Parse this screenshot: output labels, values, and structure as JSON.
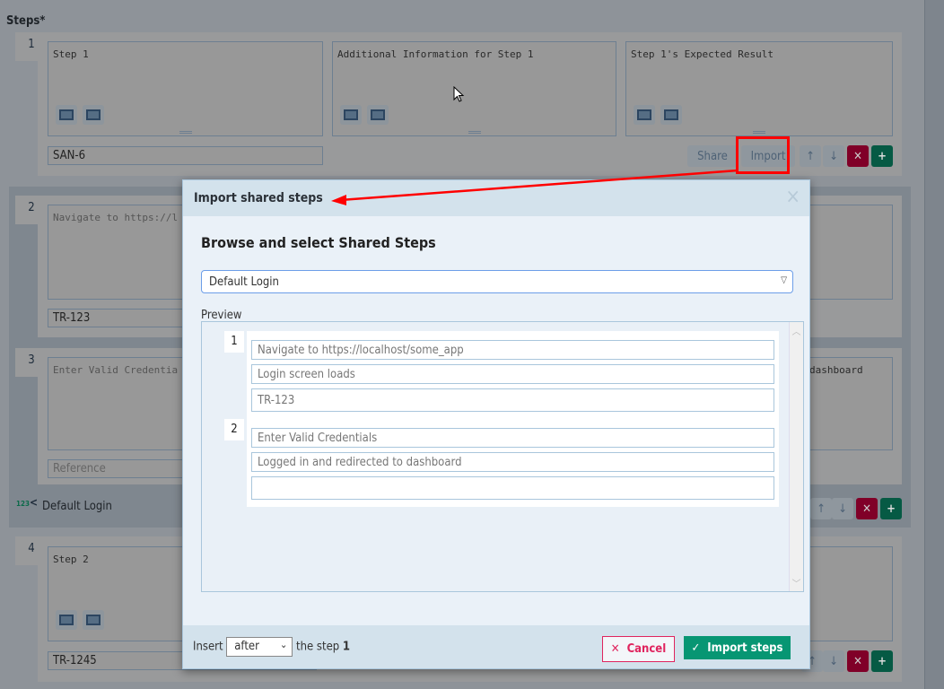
{
  "page": {
    "steps_label": "Steps",
    "required_mark": "*"
  },
  "steps": [
    {
      "number": "1",
      "step": "Step 1",
      "info": "Additional Information for Step 1",
      "expected": "Step 1's Expected Result",
      "reference": "SAN-6"
    },
    {
      "number": "2",
      "step": "Navigate to https://l",
      "reference": "TR-123"
    },
    {
      "number": "3",
      "step": "Enter Valid Credentia",
      "expected": "dashboard",
      "reference_placeholder": "Reference"
    },
    {
      "number": "4",
      "step": "Step 2",
      "reference": "TR-1245"
    }
  ],
  "shared_group": {
    "label": "Default Login",
    "icon": "shared-steps-icon",
    "icon_text": "123"
  },
  "actions": {
    "share": "Share",
    "import": "Import",
    "up": "↑",
    "down": "↓",
    "delete": "✕",
    "add": "+"
  },
  "modal": {
    "title": "Import shared steps",
    "close": "×",
    "heading": "Browse and select Shared Steps",
    "selected": "Default Login",
    "preview_label": "Preview",
    "preview_steps": [
      {
        "number": "1",
        "step": "Navigate to https://localhost/some_app",
        "expected": "Login screen loads",
        "reference": "TR-123"
      },
      {
        "number": "2",
        "step": "Enter Valid Credentials",
        "expected": "Logged in and redirected to dashboard",
        "reference": ""
      }
    ],
    "footer": {
      "insert": "Insert",
      "position": "after",
      "the_step": "the step",
      "step_number": "1",
      "cancel": "Cancel",
      "import": "Import steps"
    }
  },
  "colors": {
    "annotation": "#ff0000",
    "import_button": "#079673",
    "cancel": "#e0245e",
    "delete": "#800028",
    "add": "#065a44"
  }
}
